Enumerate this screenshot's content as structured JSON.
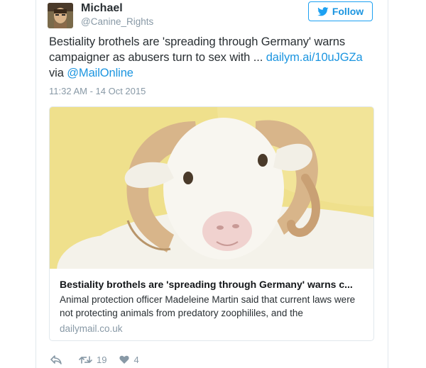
{
  "author": {
    "name": "Michael",
    "handle": "@Canine_Rights"
  },
  "follow_label": "Follow",
  "tweet": {
    "text": "Bestiality brothels are 'spreading through Germany' warns campaigner as abusers turn to sex with ... ",
    "link": "dailym.ai/10uJGZa",
    "via": "via ",
    "mention": "@MailOnline",
    "timestamp": "11:32 AM - 14 Oct 2015"
  },
  "card": {
    "title": "Bestiality brothels are 'spreading through Germany' warns c...",
    "description": "Animal protection officer Madeleine Martin said that current laws were not protecting animals from predatory zoophililes, and the",
    "domain": "dailymail.co.uk"
  },
  "actions": {
    "retweets": "19",
    "likes": "4"
  },
  "colors": {
    "accent": "#1b95e0",
    "text": "#292f33",
    "muted": "#8899a6",
    "card_bg": "#efe08c"
  }
}
